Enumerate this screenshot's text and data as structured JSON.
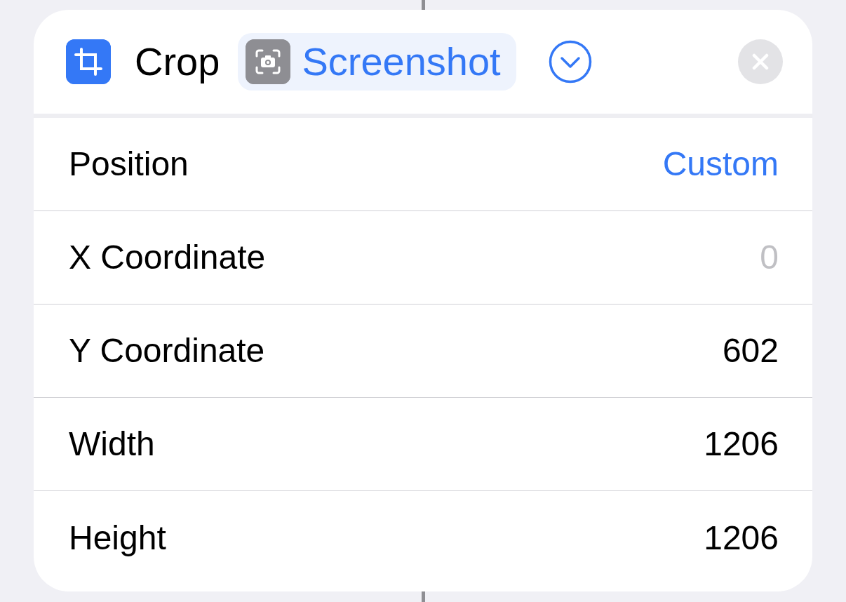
{
  "action": {
    "title": "Crop",
    "input": {
      "label": "Screenshot"
    },
    "expanded": false
  },
  "rows": [
    {
      "label": "Position",
      "kind": "picker",
      "value": "Custom"
    },
    {
      "label": "X Coordinate",
      "kind": "number",
      "placeholder": "0"
    },
    {
      "label": "Y Coordinate",
      "kind": "number",
      "value": "602"
    },
    {
      "label": "Width",
      "kind": "number",
      "value": "1206"
    },
    {
      "label": "Height",
      "kind": "number",
      "value": "1206"
    }
  ]
}
